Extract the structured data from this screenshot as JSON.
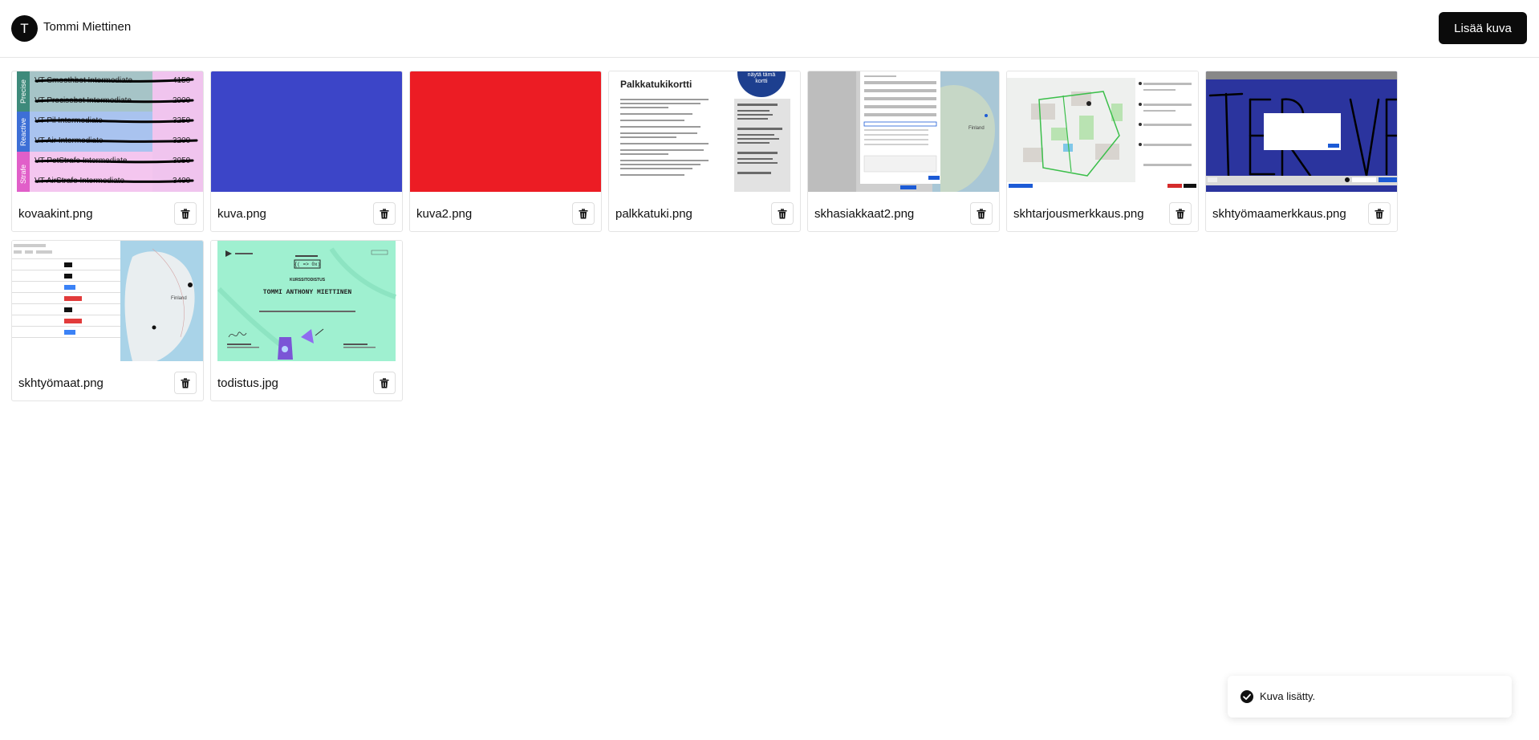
{
  "user": {
    "initial": "T",
    "name": "Tommi Miettinen"
  },
  "header": {
    "add_button_label": "Lisää kuva"
  },
  "colors": {
    "primary": "#0b0b0b",
    "blue_image": "#3c45c8",
    "red_image": "#ec1c24",
    "certificate_green": "#9ff0d0"
  },
  "images": [
    {
      "filename": "kovaakint.png",
      "thumbnail": "tier-list"
    },
    {
      "filename": "kuva.png",
      "thumbnail": "solid-blue"
    },
    {
      "filename": "kuva2.png",
      "thumbnail": "solid-red"
    },
    {
      "filename": "palkkatuki.png",
      "thumbnail": "document",
      "heading": "Palkkatukikortti",
      "badge": [
        "näytä tämä",
        "kortti"
      ]
    },
    {
      "filename": "skhasiakkaat2.png",
      "thumbnail": "map-dialog",
      "map_label": "Finland"
    },
    {
      "filename": "skhtarjousmerkkaus.png",
      "thumbnail": "site-map"
    },
    {
      "filename": "skhtyömaamerkkaus.png",
      "thumbnail": "drawing"
    },
    {
      "filename": "skhtyömaat.png",
      "thumbnail": "table-map",
      "map_label": "Finland"
    },
    {
      "filename": "todistus.jpg",
      "thumbnail": "certificate",
      "cert_title": "KURSSITODISTUS",
      "cert_name": "TOMMI ANTHONY MIETTINEN"
    }
  ],
  "tierlist": {
    "groups": [
      "Precise",
      "Reactive",
      "Strafe"
    ],
    "rows": [
      {
        "name": "VT Smoothbot Intermediate",
        "score": "4150"
      },
      {
        "name": "VT Precisebot Intermediate",
        "score": "2900"
      },
      {
        "name": "VT Pil Intermediate",
        "score": "3250"
      },
      {
        "name": "VT Air Intermediate",
        "score": "3200"
      },
      {
        "name": "VT PetStrafe Intermediate",
        "score": "3050"
      },
      {
        "name": "VT AirStrafe Intermediate",
        "score": "3400"
      }
    ]
  },
  "delete_icon": "trash-icon",
  "toast": {
    "icon": "check-circle-icon",
    "message": "Kuva lisätty."
  }
}
